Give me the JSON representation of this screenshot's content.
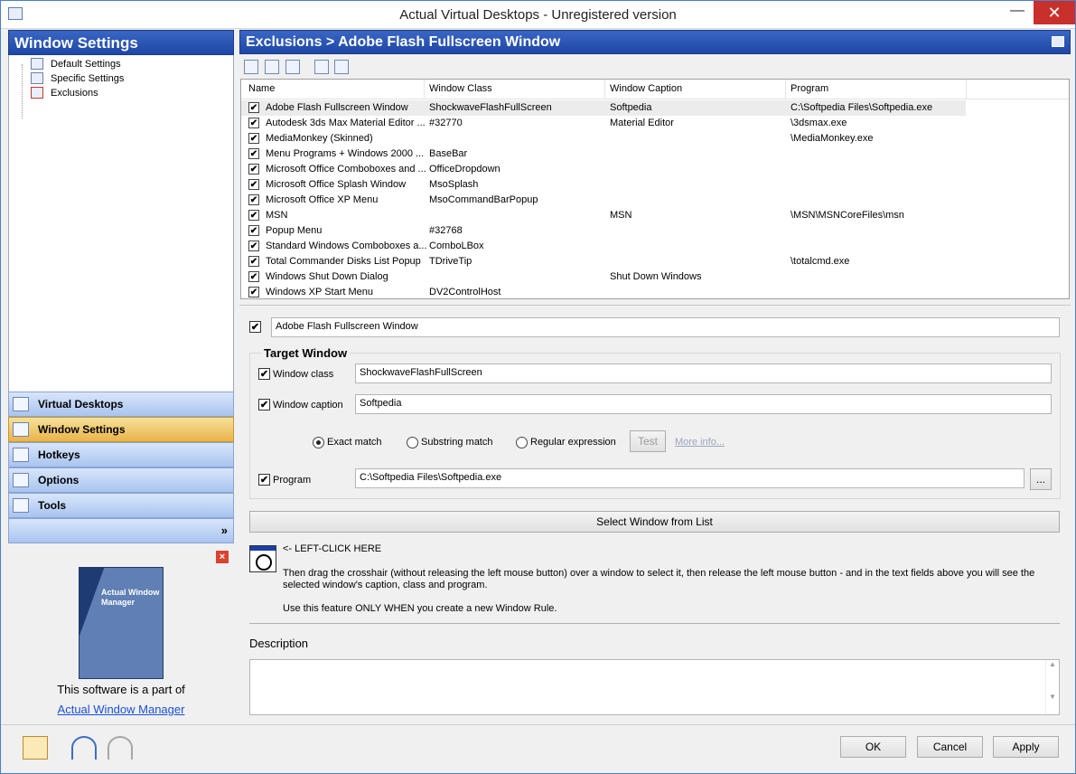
{
  "window": {
    "title": "Actual Virtual Desktops - Unregistered version"
  },
  "left": {
    "header": "Window Settings",
    "tree": [
      "Default Settings",
      "Specific Settings",
      "Exclusions"
    ],
    "nav": [
      "Virtual Desktops",
      "Window Settings",
      "Hotkeys",
      "Options",
      "Tools"
    ],
    "more": "»",
    "promo": {
      "box_text": "Actual Window Manager",
      "line1": "This software is a part of",
      "link": "Actual Window Manager",
      "close": "×"
    }
  },
  "right": {
    "header": "Exclusions > Adobe Flash Fullscreen Window",
    "columns": [
      "Name",
      "Window Class",
      "Window Caption",
      "Program"
    ],
    "rows": [
      {
        "name": "Adobe Flash Fullscreen Window",
        "class": "ShockwaveFlashFullScreen",
        "caption": "Softpedia",
        "program": "C:\\Softpedia Files\\Softpedia.exe"
      },
      {
        "name": "Autodesk 3ds Max Material Editor ...",
        "class": "#32770",
        "caption": "Material Editor",
        "program": "\\3dsmax.exe"
      },
      {
        "name": "MediaMonkey (Skinned)",
        "class": "",
        "caption": "",
        "program": "\\MediaMonkey.exe"
      },
      {
        "name": "Menu Programs + Windows 2000 ...",
        "class": "BaseBar",
        "caption": "",
        "program": ""
      },
      {
        "name": "Microsoft Office Comboboxes and ...",
        "class": "OfficeDropdown",
        "caption": "",
        "program": ""
      },
      {
        "name": "Microsoft Office Splash Window",
        "class": "MsoSplash",
        "caption": "",
        "program": ""
      },
      {
        "name": "Microsoft Office XP Menu",
        "class": "MsoCommandBarPopup",
        "caption": "",
        "program": ""
      },
      {
        "name": "MSN",
        "class": "",
        "caption": "MSN",
        "program": "\\MSN\\MSNCoreFiles\\msn"
      },
      {
        "name": "Popup Menu",
        "class": "#32768",
        "caption": "",
        "program": ""
      },
      {
        "name": "Standard Windows Comboboxes a...",
        "class": "ComboLBox",
        "caption": "",
        "program": ""
      },
      {
        "name": "Total Commander Disks List Popup",
        "class": "TDriveTip",
        "caption": "",
        "program": "\\totalcmd.exe"
      },
      {
        "name": "Windows Shut Down Dialog",
        "class": "",
        "caption": "Shut Down Windows",
        "program": ""
      },
      {
        "name": "Windows XP Start Menu",
        "class": "DV2ControlHost",
        "caption": "",
        "program": ""
      }
    ],
    "rule_name": "Adobe Flash Fullscreen Window",
    "target": {
      "title": "Target Window",
      "class_label": "Window class",
      "class_value": "ShockwaveFlashFullScreen",
      "caption_label": "Window caption",
      "caption_value": "Softpedia",
      "match_exact": "Exact match",
      "match_substring": "Substring match",
      "match_regex": "Regular expression",
      "test": "Test",
      "more_info": "More info...",
      "program_label": "Program",
      "program_value": "C:\\Softpedia Files\\Softpedia.exe",
      "browse": "..."
    },
    "select_button": "Select Window from List",
    "left_click": "<- LEFT-CLICK HERE",
    "help1": "Then drag the crosshair (without releasing the left mouse button) over a window to select it, then release the left mouse button - and in the text fields above you will see the selected window's caption, class and program.",
    "help2": "Use this feature ONLY WHEN you create a new Window Rule.",
    "description_label": "Description"
  },
  "buttons": {
    "ok": "OK",
    "cancel": "Cancel",
    "apply": "Apply"
  },
  "checkmark": "✔"
}
